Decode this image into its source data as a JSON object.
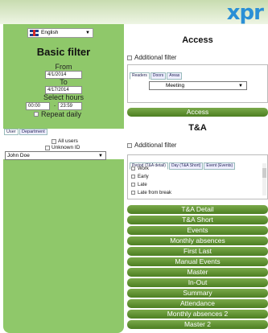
{
  "header": {
    "logo": "xpr"
  },
  "sidebar": {
    "language": {
      "value": "English"
    },
    "title": "Basic filter",
    "from_label": "From",
    "from_value": "4/1/2014",
    "to_label": "To",
    "to_value": "4/17/2014",
    "hours_label": "Select hours",
    "hour_from": "00:00",
    "hour_sep": "-",
    "hour_to": "23:59",
    "repeat_daily": "Repeat daily",
    "tabs": [
      "User",
      "Department"
    ],
    "all_users": "All users",
    "unknown_id": "Unknown ID",
    "user_select": "John Doe"
  },
  "access": {
    "title": "Access",
    "additional_filter": "Additional filter",
    "tabs": [
      "Readers",
      "Doors",
      "Areas"
    ],
    "select_value": "Meeting",
    "button": "Access"
  },
  "ta": {
    "title": "T&A",
    "additional_filter": "Additional filter",
    "tabs": [
      "Period (T&A detail)",
      "Day (T&A Short)",
      "Event (Events)"
    ],
    "items": [
      "Work",
      "Early",
      "Late",
      "Late from break"
    ],
    "buttons": [
      "T&A Detail",
      "T&A Short",
      "Events",
      "Monthly absences",
      "First Last",
      "Manual Events",
      "Master",
      "In-Out",
      "Summary",
      "Attendance",
      "Monthly absences 2",
      "Master 2"
    ]
  }
}
